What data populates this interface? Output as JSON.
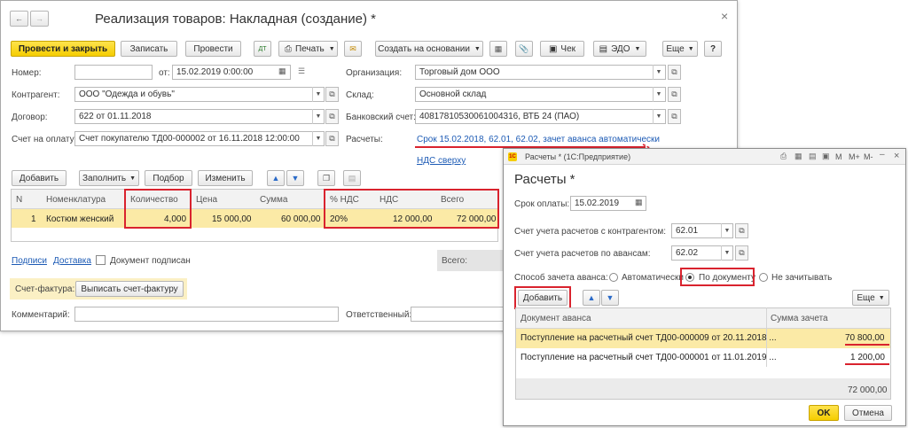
{
  "main": {
    "title": "Реализация товаров: Накладная (создание) *",
    "toolbar": {
      "post_close": "Провести и закрыть",
      "save": "Записать",
      "post": "Провести",
      "print": "Печать",
      "create_based": "Создать на основании",
      "check": "Чек",
      "edo": "ЭДО",
      "more": "Еще",
      "help": "?"
    },
    "fields": {
      "number_label": "Номер:",
      "number_value": "",
      "date_label": "от:",
      "date_value": "15.02.2019  0:00:00",
      "org_label": "Организация:",
      "org_value": "Торговый дом ООО",
      "counterparty_label": "Контрагент:",
      "counterparty_value": "ООО \"Одежда и обувь\"",
      "warehouse_label": "Склад:",
      "warehouse_value": "Основной склад",
      "contract_label": "Договор:",
      "contract_value": "622 от 01.11.2018",
      "bank_label": "Банковский счет:",
      "bank_value": "40817810530061004316, ВТБ 24 (ПАО)",
      "invoice_label": "Счет на оплату:",
      "invoice_value": "Счет покупателю ТД00-000002 от 16.11.2018 12:00:00",
      "settlements_label": "Расчеты:",
      "settlements_link": "Срок 15.02.2018, 62.01, 62.02, зачет аванса автоматически",
      "vat_link": "НДС сверху"
    },
    "table_toolbar": {
      "add": "Добавить",
      "fill": "Заполнить",
      "select": "Подбор",
      "change": "Изменить"
    },
    "table": {
      "headers": [
        "N",
        "Номенклатура",
        "Количество",
        "Цена",
        "Сумма",
        "% НДС",
        "НДС",
        "Всего"
      ],
      "rows": [
        [
          "1",
          "Костюм женский",
          "4,000",
          "15 000,00",
          "60 000,00",
          "20%",
          "12 000,00",
          "72 000,00"
        ]
      ]
    },
    "footer": {
      "signatures": "Подписи",
      "delivery": "Доставка",
      "doc_signed": "Документ подписан",
      "total_label": "Всего:",
      "invoice_label": "Счет-фактура:",
      "issue_invoice": "Выписать счет-фактуру",
      "comment_label": "Комментарий:",
      "responsible_label": "Ответственный:"
    }
  },
  "dialog": {
    "window_title": "Расчеты * (1С:Предприятие)",
    "heading": "Расчеты *",
    "titlebar_buttons": [
      "M",
      "M+",
      "M-"
    ],
    "due_label": "Срок оплаты:",
    "due_value": "15.02.2019",
    "acc_counterparty_label": "Счет учета расчетов с контрагентом:",
    "acc_counterparty_value": "62.01",
    "acc_advance_label": "Счет учета расчетов по авансам:",
    "acc_advance_value": "62.02",
    "method_label": "Способ зачета аванса:",
    "radio_auto": "Автоматически",
    "radio_doc": "По документу",
    "radio_none": "Не зачитывать",
    "add": "Добавить",
    "more": "Еще",
    "table": {
      "headers": [
        "Документ аванса",
        "Сумма зачета"
      ],
      "rows": [
        [
          "Поступление на расчетный счет ТД00-000009 от 20.11.2018 ...",
          "70 800,00"
        ],
        [
          "Поступление на расчетный счет ТД00-000001 от 11.01.2019 ...",
          "1 200,00"
        ]
      ],
      "total": "72 000,00"
    },
    "ok": "OK",
    "cancel": "Отмена"
  },
  "colors": {
    "accent_yellow": "#f5cd00",
    "highlight_red": "#d9232e",
    "link_blue": "#1d5bb5",
    "row_selected": "#fbeaa6"
  }
}
